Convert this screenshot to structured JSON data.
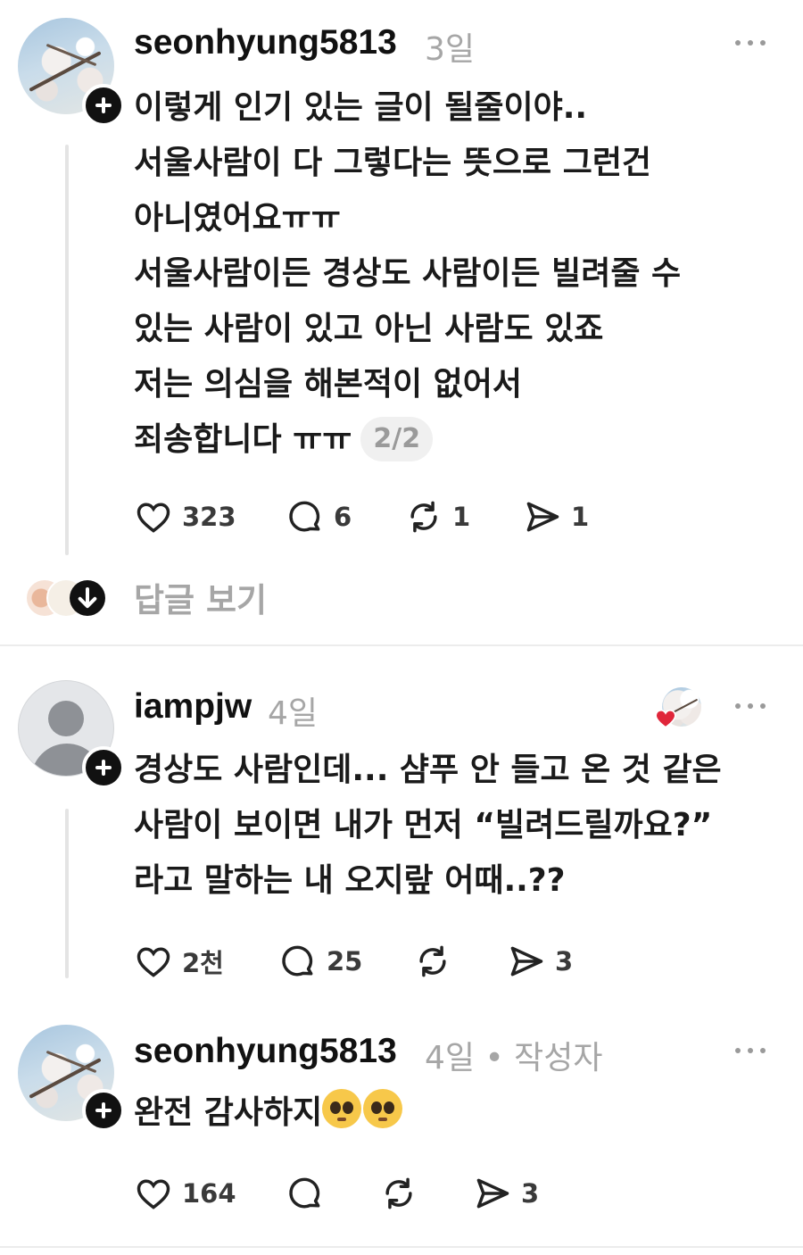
{
  "posts": [
    {
      "username": "seonhyung5813",
      "time": "3일",
      "lines": [
        "이렇게 인기 있는 글이 될줄이야..",
        "서울사람이 다 그렇다는 뜻으로 그런건",
        "아니였어요ㅠㅠ",
        "서울사람이든 경상도 사람이든 빌려줄 수",
        "있는 사람이 있고 아닌 사람도 있죠",
        "저는 의심을 해본적이 없어서",
        "죄송합니다 ㅠㅠ"
      ],
      "page_indicator": "2/2",
      "likes": "323",
      "comments": "6",
      "reposts": "1",
      "shares": "1",
      "view_replies": "답글 보기"
    },
    {
      "username": "iampjw",
      "time": "4일",
      "lines": [
        "경상도 사람인데... 샴푸 안 들고 온 것 같은",
        "사람이 보이면 내가 먼저 “빌려드릴까요?”",
        "라고 말하는 내 오지랖 어때..??"
      ],
      "likes": "2천",
      "comments": "25",
      "reposts": "",
      "shares": "3"
    },
    {
      "username": "seonhyung5813",
      "time": "4일",
      "author_badge": "• 작성자",
      "lines": [
        "완전 감사하지"
      ],
      "emojis": [
        "pleading-face-emoji",
        "pleading-face-emoji"
      ],
      "likes": "164",
      "comments": "",
      "reposts": "",
      "shares": "3"
    }
  ],
  "icons": {
    "like": "heart-icon",
    "comment": "speech-bubble-icon",
    "repost": "repost-icon",
    "share": "send-icon",
    "more": "more-dots-icon",
    "follow": "plus-icon",
    "expand": "arrow-down-icon"
  },
  "colors": {
    "accent_heart": "#e0263a",
    "muted_text": "#a6a6a6",
    "primary_text": "#111111"
  }
}
